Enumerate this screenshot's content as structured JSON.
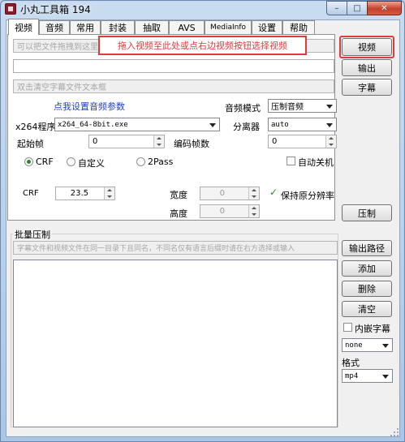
{
  "window": {
    "title": "小丸工具箱 194"
  },
  "caption_buttons": {
    "minimize": "–",
    "maximize": "□",
    "close": "✕"
  },
  "tabs": [
    {
      "label": "视频",
      "active": true
    },
    {
      "label": "音频"
    },
    {
      "label": "常用"
    },
    {
      "label": "封装"
    },
    {
      "label": "抽取"
    },
    {
      "label": "AVS"
    },
    {
      "label": "MediaInfo"
    },
    {
      "label": "设置"
    },
    {
      "label": "帮助"
    }
  ],
  "video": {
    "video_file_placeholder": "可以把文件拖拽到这里",
    "overlay_hint": "拖入视频至此处或点右边视频按钮选择视频",
    "output_value": "",
    "subtitle_placeholder": "双击清空字幕文件文本框",
    "audio_settings_link": "点我设置音频参数",
    "audio_mode_label": "音频模式",
    "audio_mode_value": "压制音频",
    "x264_label": "x264程序",
    "x264_value": "x264_64-8bit.exe",
    "splitter_label": "分离器",
    "splitter_value": "auto",
    "start_frame_label": "起始帧",
    "start_frame_value": "0",
    "encode_frames_label": "编码帧数",
    "encode_frames_value": "0",
    "mode_crf": "CRF",
    "mode_custom": "自定义",
    "mode_2pass": "2Pass",
    "auto_shutdown": "自动关机",
    "crf_label": "CRF",
    "crf_value": "23.5",
    "width_label": "宽度",
    "width_value": "0",
    "height_label": "高度",
    "height_value": "0",
    "keep_resolution": "保持原分辨率"
  },
  "right_buttons": {
    "video": "视频",
    "output": "输出",
    "subtitle": "字幕",
    "encode": "压制"
  },
  "batch": {
    "title": "批量压制",
    "hint": "字幕文件和视频文件在同一目录下且同名，不同名仅有语言后缀时请在右方选择或输入",
    "output_path": "输出路径",
    "add": "添加",
    "delete": "删除",
    "clear": "清空",
    "embed_subtitle": "内嵌字幕",
    "subtitle_lang": "none",
    "format_label": "格式",
    "format_value": "mp4"
  }
}
